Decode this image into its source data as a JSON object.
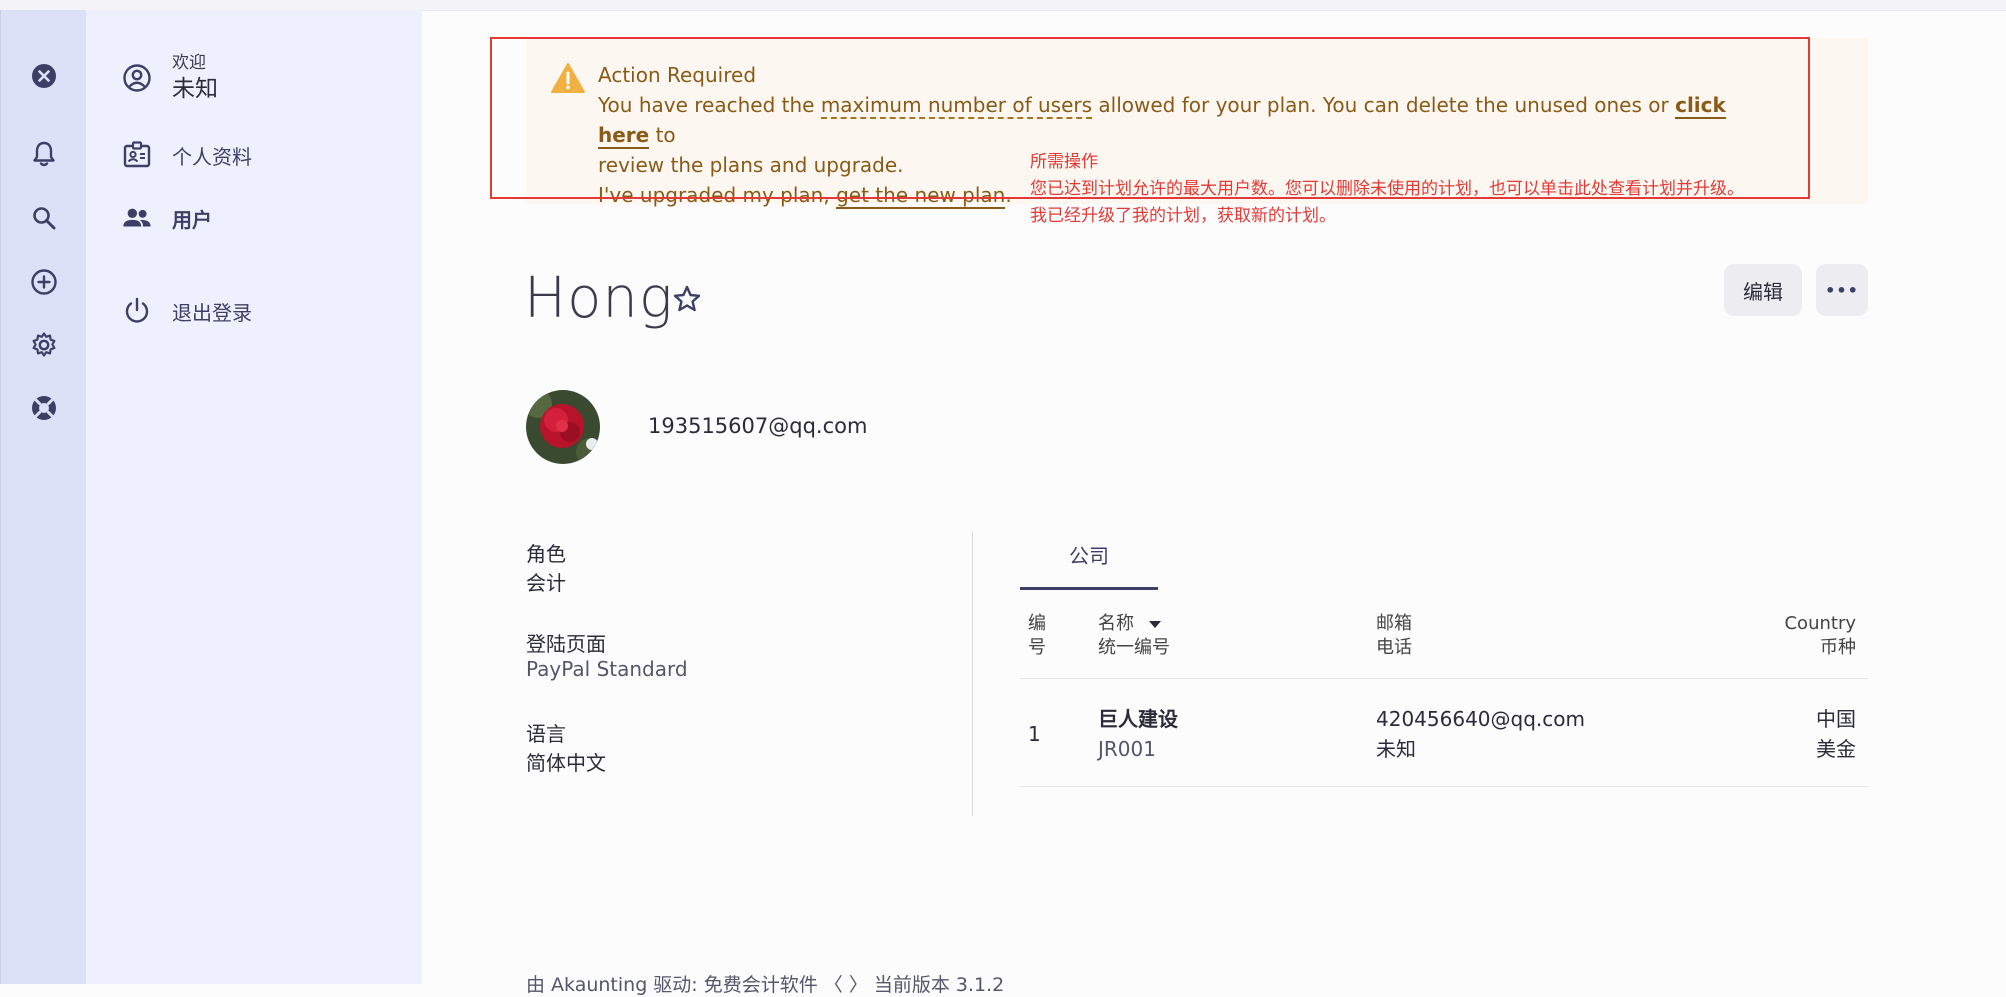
{
  "rail": {
    "icons": [
      "close-circle-icon",
      "bell-icon",
      "search-icon",
      "add-circle-icon",
      "gear-icon",
      "lifebuoy-icon"
    ]
  },
  "menu": {
    "welcome_label": "欢迎",
    "user_name": "未知",
    "profile_label": "个人资料",
    "users_label": "用户",
    "logout_label": "退出登录"
  },
  "alert": {
    "title": "Action Required",
    "line1_prefix": "You have reached the ",
    "line1_link": "maximum number of users",
    "line1_middle": " allowed for your plan. You can delete the unused ones or ",
    "line1_click": "click here",
    "line1_suffix": " to",
    "line2": "review the plans and upgrade.",
    "line3_prefix": "I've upgraded my plan, ",
    "line3_link": "get the new plan",
    "line3_suffix": "."
  },
  "annotation": {
    "line1": "所需操作",
    "line2": "您已达到计划允许的最大用户数。您可以删除未使用的计划，也可以单击此处查看计划并升级。",
    "line3": "我已经升级了我的计划，获取新的计划。"
  },
  "header": {
    "title": "Hong",
    "edit_label": "编辑",
    "more_label": "•••"
  },
  "profile": {
    "email": "193515607@qq.com"
  },
  "details": {
    "role_label": "角色",
    "role_value": "会计",
    "landing_label": "登陆页面",
    "landing_value": "PayPal Standard",
    "language_label": "语言",
    "language_value": "简体中文"
  },
  "companies": {
    "tab_label": "公司",
    "headers": {
      "id_line1": "编",
      "id_line2": "号",
      "name": "名称",
      "tax": "统一编号",
      "email": "邮箱",
      "phone": "电话",
      "country": "Country",
      "currency": "币种"
    },
    "rows": [
      {
        "id": "1",
        "name": "巨人建设",
        "tax": "JR001",
        "email": "420456640@qq.com",
        "phone": "未知",
        "country": "中国",
        "currency": "美金"
      }
    ]
  },
  "footer": {
    "text": "由 Akaunting 驱动: 免费会计软件 〈 〉 当前版本 3.1.2"
  },
  "colors": {
    "rail_bg": "#dde1f8",
    "menu_bg": "#eef0fd",
    "accent": "#3d3f66",
    "alert_text": "#8a5a17",
    "alert_icon": "#f0b042",
    "annotation_red": "#e53935"
  }
}
